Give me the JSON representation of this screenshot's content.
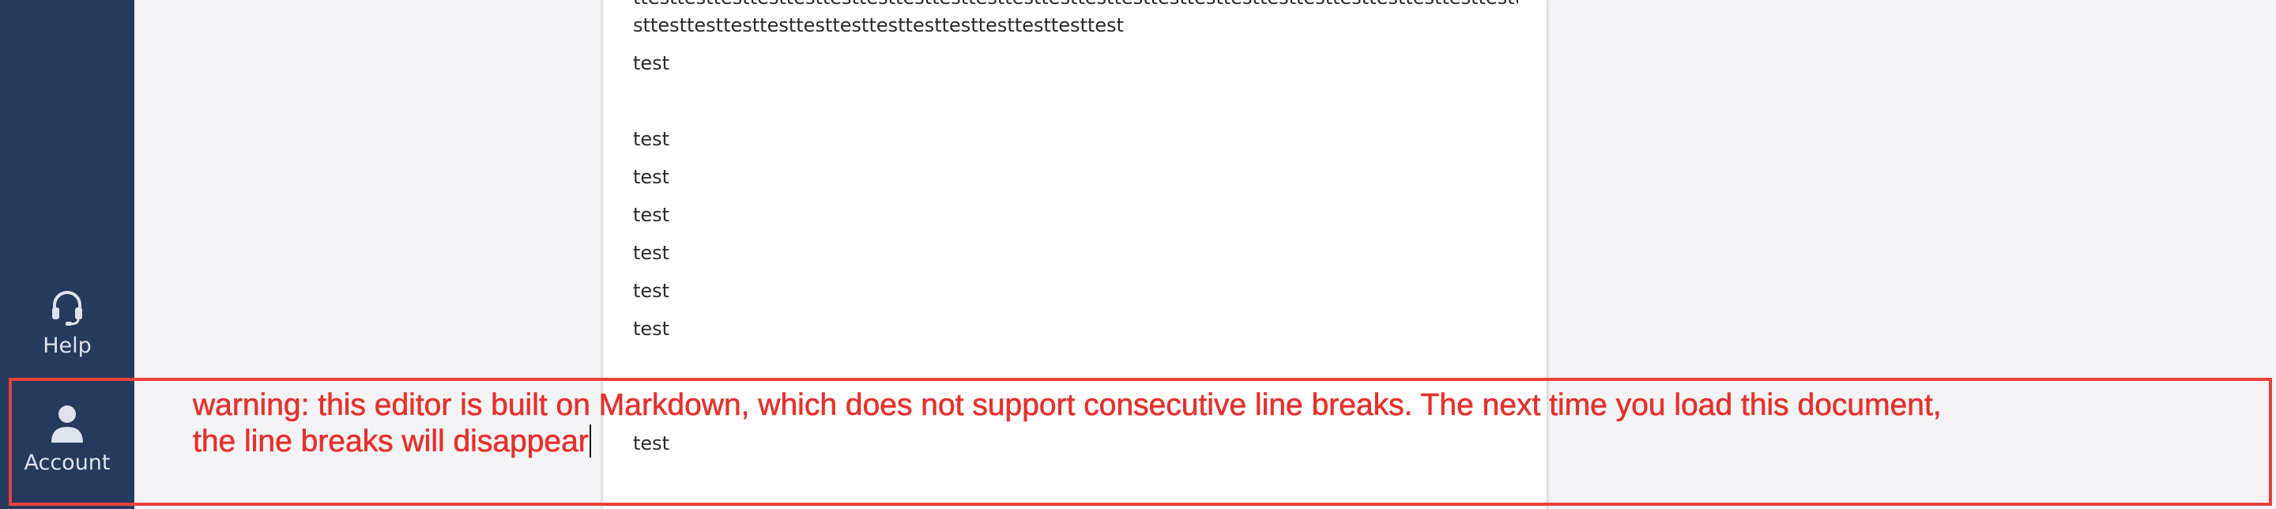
{
  "sidebar": {
    "items": [
      {
        "label": "Help",
        "icon": "headset-icon"
      },
      {
        "label": "Account",
        "icon": "user-icon"
      }
    ]
  },
  "editor": {
    "long_text_line1": "ttesttesttesttesttesttesttesttesttesttesttesttesttesttesttesttesttesttesttesttesttesttesttesttesttesttesttesttestte",
    "long_text_line2": "sttesttesttesttesttesttesttesttesttesttesttesttesttest",
    "paragraphs": [
      "test",
      "",
      "test",
      "test",
      "test",
      "test",
      "test",
      "test",
      "test"
    ]
  },
  "warning": {
    "line1": "warning: this editor is built on Markdown, which does not support consecutive line breaks. The next time you load this document,",
    "line2": "the line breaks will disappear"
  },
  "colors": {
    "sidebar_bg": "#263a5e",
    "warning_red": "#e8302b",
    "page_bg": "#f4f4f6"
  }
}
